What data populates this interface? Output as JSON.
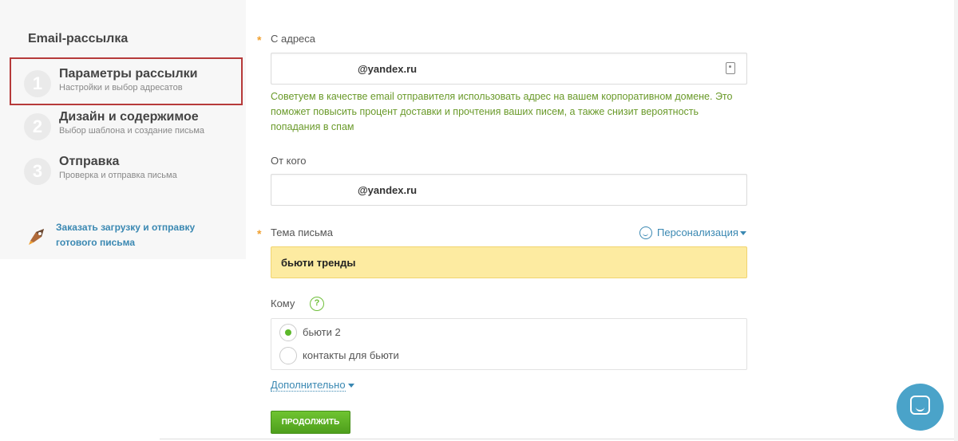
{
  "sidebar": {
    "title": "Email-рассылка",
    "steps": [
      {
        "num": "1",
        "title": "Параметры рассылки",
        "subtitle": "Настройки и выбор адресатов"
      },
      {
        "num": "2",
        "title": "Дизайн и содержимое",
        "subtitle": "Выбор шаблона и создание письма"
      },
      {
        "num": "3",
        "title": "Отправка",
        "subtitle": "Проверка и отправка письма"
      }
    ],
    "promo": {
      "icon": "rocket-icon",
      "text": "Заказать загрузку и отправку готового письма"
    }
  },
  "form": {
    "from_address": {
      "label": "С адреса",
      "value": "@yandex.ru",
      "hint": "Советуем в качестве email отправителя использовать адрес на вашем корпоративном домене. Это поможет повысить процент доставки и прочтения ваших писем, а также снизит вероятность попадания в спам"
    },
    "from_name": {
      "label": "От кого",
      "value": "@yandex.ru"
    },
    "subject": {
      "label": "Тема письма",
      "value": "бьюти тренды",
      "personalize_label": "Персонализация"
    },
    "recipients": {
      "label": "Кому",
      "help_symbol": "?",
      "options": [
        {
          "label": "бьюти 2",
          "checked": true
        },
        {
          "label": "контакты для бьюти",
          "checked": false
        }
      ]
    },
    "more_label": "Дополнительно",
    "continue_label": "ПРОДОЛЖИТЬ"
  },
  "colors": {
    "link": "#3a88b2",
    "accent_green": "#5cb82a",
    "hint_green": "#6a9a2a",
    "subject_bg": "#fdeba1",
    "highlight_border": "#b63a3a",
    "chat_button": "#4aa3c9"
  }
}
